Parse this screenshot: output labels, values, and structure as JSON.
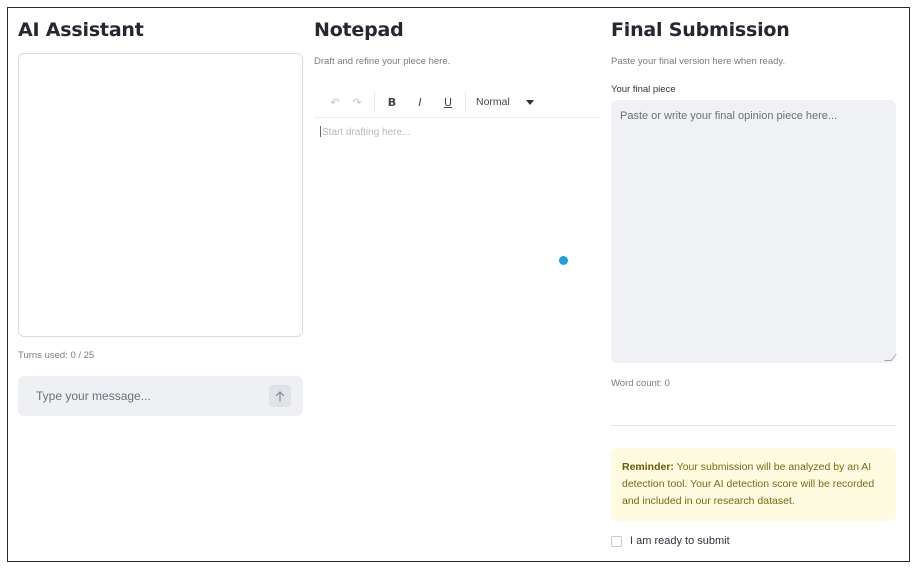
{
  "assistant": {
    "title": "AI Assistant",
    "turns_used": "Turns used: 0 / 25",
    "input_placeholder": "Type your message...",
    "send_icon": "arrow-up-icon"
  },
  "notepad": {
    "title": "Notepad",
    "subtitle": "Draft and refine your piece here.",
    "toolbar": {
      "undo_glyph": "↶",
      "redo_glyph": "↷",
      "bold_label": "B",
      "italic_label": "I",
      "underline_label": "U",
      "format_value": "Normal"
    },
    "editor_placeholder": "Start drafting here..."
  },
  "submission": {
    "title": "Final Submission",
    "subtitle": "Paste your final version here when ready.",
    "field_label": "Your final piece",
    "field_placeholder": "Paste or write your final opinion piece here...",
    "word_count": "Word count: 0",
    "reminder_bold": "Reminder:",
    "reminder_text": " Your submission will be analyzed by an AI detection tool. Your AI detection score will be recorded and included in our research dataset.",
    "checkbox_label": "I am ready to submit"
  },
  "colors": {
    "accent_dot": "#1e9ee0",
    "reminder_bg": "#fefbe0",
    "input_bg": "#eff0f4"
  }
}
